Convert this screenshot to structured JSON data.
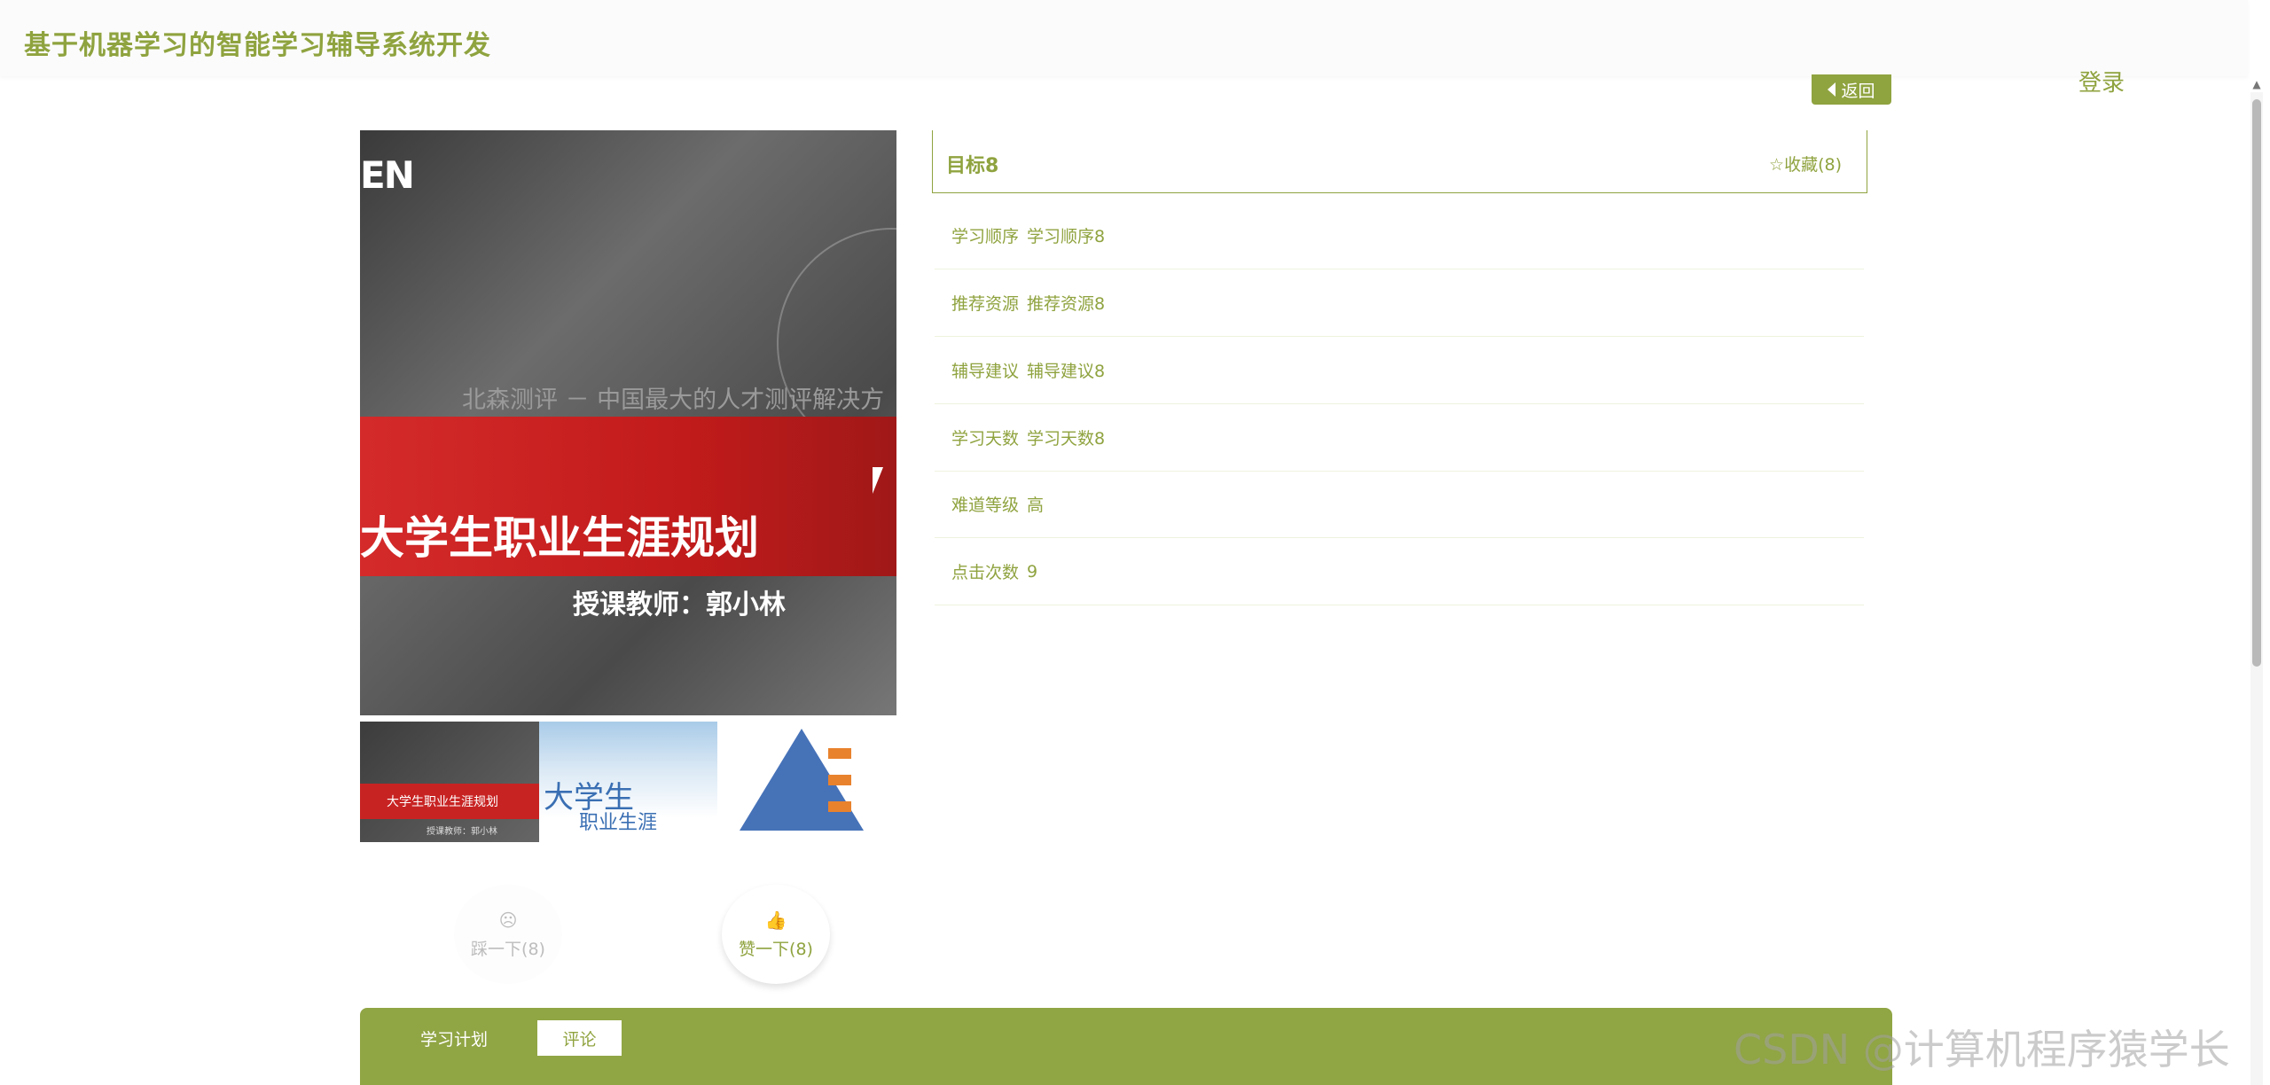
{
  "header": {
    "site_title": "基于机器学习的智能学习辅导系统开发",
    "login": "登录",
    "back": "返回"
  },
  "media": {
    "logo": "EN",
    "subtitle": "北森测评 － 中国最大的人才测评解决方",
    "title": "大学生职业生涯规划",
    "teacher": "授课教师：郭小林",
    "thumb1_title": "大学生职业生涯规划",
    "thumb1_sub": "授课教师：郭小林",
    "thumb2_line1": "大学生",
    "thumb2_line2": "职业生涯"
  },
  "votes": {
    "down": "踩一下(8)",
    "up": "赞一下(8)"
  },
  "detail": {
    "title": "目标8",
    "favorite": "收藏(8)",
    "rows": [
      {
        "label": "学习顺序",
        "value": "学习顺序8"
      },
      {
        "label": "推荐资源",
        "value": "推荐资源8"
      },
      {
        "label": "辅导建议",
        "value": "辅导建议8"
      },
      {
        "label": "学习天数",
        "value": "学习天数8"
      },
      {
        "label": "难道等级",
        "value": "高"
      },
      {
        "label": "点击次数",
        "value": "9"
      }
    ]
  },
  "tabs": {
    "plan": "学习计划",
    "comment": "评论"
  },
  "watermark": "CSDN @计算机程序猿学长",
  "colors": {
    "accent": "#8fa33f",
    "tabbar": "#90a544"
  }
}
